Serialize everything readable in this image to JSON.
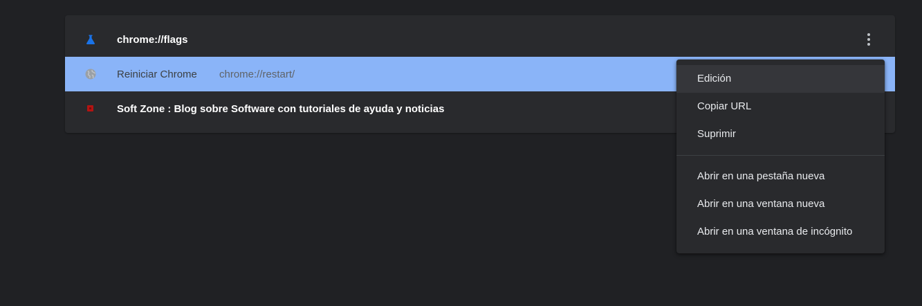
{
  "rows": [
    {
      "title": "chrome://flags",
      "url": "",
      "icon": "flask-icon",
      "icon_color": "#1a73e8"
    },
    {
      "title": "Reiniciar Chrome",
      "url": "chrome://restart/",
      "icon": "globe-icon",
      "icon_color": "#9aa0a6",
      "selected": true
    },
    {
      "title": "Soft Zone : Blog sobre Software con tutoriales de ayuda y noticias",
      "url": "",
      "icon": "site-favicon",
      "icon_color": "#b31412"
    }
  ],
  "menu_button_icon": "more-vert-icon",
  "context_menu": {
    "group1": [
      "Edición",
      "Copiar URL",
      "Suprimir"
    ],
    "group2": [
      "Abrir en una pestaña nueva",
      "Abrir en una ventana nueva",
      "Abrir en una ventana de incógnito"
    ]
  },
  "colors": {
    "background": "#202124",
    "card": "#292a2d",
    "selected_row": "#8ab4f8",
    "menu_hover": "#35363a"
  }
}
